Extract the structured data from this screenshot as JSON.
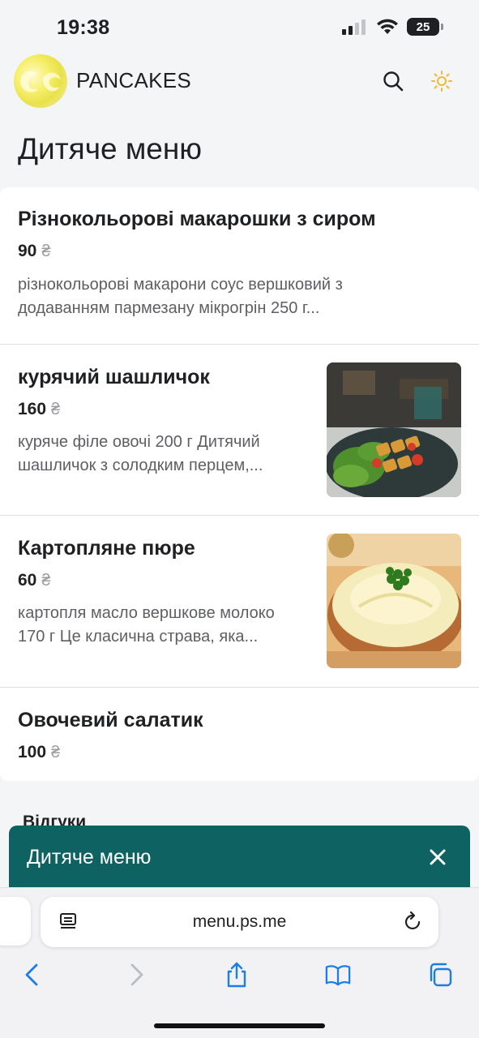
{
  "status": {
    "time": "19:38",
    "battery": "25"
  },
  "header": {
    "brand": "PANCAKES"
  },
  "page": {
    "title": "Дитяче меню"
  },
  "menu": {
    "items": [
      {
        "name": "Різнокольорові макарошки з сиром",
        "price": "90",
        "currency": "₴",
        "desc1": "різнокольорові макарони соус вершковий з",
        "desc2": "додаванням пармезану мікрогрін 250 г..."
      },
      {
        "name": "курячий шашличок",
        "price": "160",
        "currency": "₴",
        "desc1": "куряче філе овочі 200 г Дитячий",
        "desc2": "шашличок з солодким перцем,..."
      },
      {
        "name": "Картопляне пюре",
        "price": "60",
        "currency": "₴",
        "desc1": "картопля масло вершкове молоко",
        "desc2": "170 г Це класична страва, яка..."
      },
      {
        "name": "Овочевий салатик",
        "price": "100",
        "currency": "₴"
      }
    ]
  },
  "reviews": {
    "label": "Відгуки"
  },
  "sheet": {
    "title": "Дитяче меню"
  },
  "browser": {
    "url": "menu.ps.me"
  },
  "colors": {
    "accent": "#0e6362",
    "link": "#1a7de8",
    "sun": "#f2b82f"
  }
}
